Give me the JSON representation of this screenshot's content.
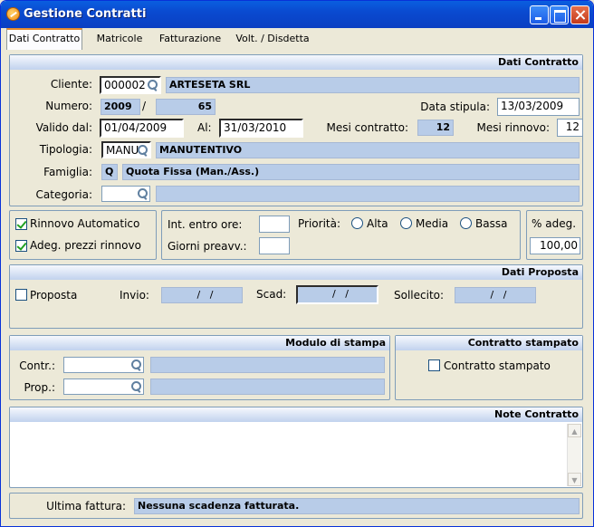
{
  "window": {
    "title": "Gestione Contratti"
  },
  "tabs": [
    {
      "label": "Dati Contratto"
    },
    {
      "label": "Matricole"
    },
    {
      "label": "Fatturazione"
    },
    {
      "label": "Volt. / Disdetta"
    }
  ],
  "contract": {
    "header": "Dati Contratto",
    "cliente_label": "Cliente:",
    "cliente_code": "000002",
    "cliente_name": "ARTESETA SRL",
    "numero_label": "Numero:",
    "numero_year": "2009",
    "numero_sep": "/",
    "numero_num": "65",
    "stipula_label": "Data stipula:",
    "stipula_value": "13/03/2009",
    "valido_label": "Valido dal:",
    "valido_value": "01/04/2009",
    "al_label": "Al:",
    "al_value": "31/03/2010",
    "mesi_contratto_label": "Mesi contratto:",
    "mesi_contratto_value": "12",
    "mesi_rinnovo_label": "Mesi rinnovo:",
    "mesi_rinnovo_value": "12",
    "tipologia_label": "Tipologia:",
    "tipologia_code": "MANU",
    "tipologia_name": "MANUTENTIVO",
    "famiglia_label": "Famiglia:",
    "famiglia_code": "Q",
    "famiglia_name": "Quota Fissa (Man./Ass.)",
    "categoria_label": "Categoria:",
    "categoria_code": "",
    "categoria_name": ""
  },
  "options": {
    "rinnovo_label": "Rinnovo Automatico",
    "adeg_label": "Adeg. prezzi rinnovo",
    "int_label": "Int. entro ore:",
    "int_value": "",
    "giorni_label": "Giorni preavv.:",
    "giorni_value": "",
    "priorita_label": "Priorità:",
    "priorita_options": [
      "Alta",
      "Media",
      "Bassa"
    ],
    "perc_label": "% adeg.",
    "perc_value": "100,00"
  },
  "proposta": {
    "header": "Dati Proposta",
    "proposta_label": "Proposta",
    "invio_label": "Invio:",
    "invio_value": "  /   /",
    "scad_label": "Scad:",
    "scad_value": "  /   /",
    "sollecito_label": "Sollecito:",
    "sollecito_value": "  /   /"
  },
  "modulo": {
    "header": "Modulo di stampa",
    "contr_label": "Contr.:",
    "prop_label": "Prop.:"
  },
  "stampato": {
    "header": "Contratto stampato",
    "label": "Contratto stampato"
  },
  "note": {
    "header": "Note Contratto",
    "value": ""
  },
  "footer": {
    "ultima_label": "Ultima fattura:",
    "ultima_value": "Nessuna scadenza fatturata."
  }
}
